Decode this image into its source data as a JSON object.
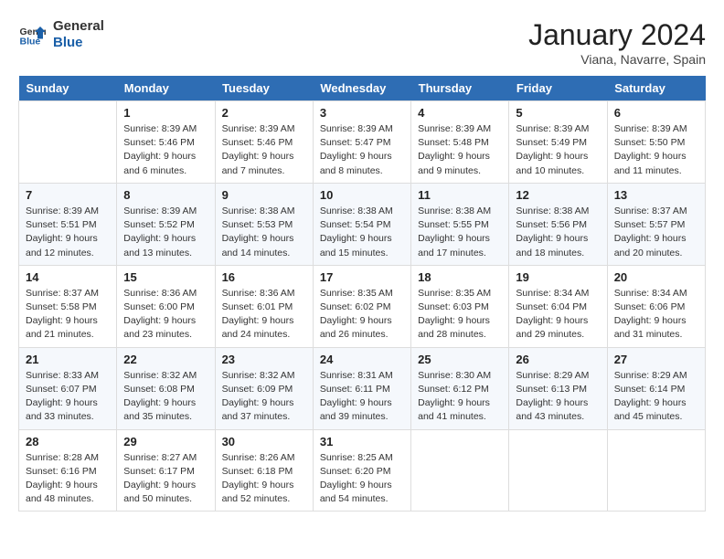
{
  "logo": {
    "line1": "General",
    "line2": "Blue"
  },
  "title": "January 2024",
  "location": "Viana, Navarre, Spain",
  "days_header": [
    "Sunday",
    "Monday",
    "Tuesday",
    "Wednesday",
    "Thursday",
    "Friday",
    "Saturday"
  ],
  "weeks": [
    [
      {
        "day": "",
        "sunrise": "",
        "sunset": "",
        "daylight": ""
      },
      {
        "day": "1",
        "sunrise": "Sunrise: 8:39 AM",
        "sunset": "Sunset: 5:46 PM",
        "daylight": "Daylight: 9 hours and 6 minutes."
      },
      {
        "day": "2",
        "sunrise": "Sunrise: 8:39 AM",
        "sunset": "Sunset: 5:46 PM",
        "daylight": "Daylight: 9 hours and 7 minutes."
      },
      {
        "day": "3",
        "sunrise": "Sunrise: 8:39 AM",
        "sunset": "Sunset: 5:47 PM",
        "daylight": "Daylight: 9 hours and 8 minutes."
      },
      {
        "day": "4",
        "sunrise": "Sunrise: 8:39 AM",
        "sunset": "Sunset: 5:48 PM",
        "daylight": "Daylight: 9 hours and 9 minutes."
      },
      {
        "day": "5",
        "sunrise": "Sunrise: 8:39 AM",
        "sunset": "Sunset: 5:49 PM",
        "daylight": "Daylight: 9 hours and 10 minutes."
      },
      {
        "day": "6",
        "sunrise": "Sunrise: 8:39 AM",
        "sunset": "Sunset: 5:50 PM",
        "daylight": "Daylight: 9 hours and 11 minutes."
      }
    ],
    [
      {
        "day": "7",
        "sunrise": "Sunrise: 8:39 AM",
        "sunset": "Sunset: 5:51 PM",
        "daylight": "Daylight: 9 hours and 12 minutes."
      },
      {
        "day": "8",
        "sunrise": "Sunrise: 8:39 AM",
        "sunset": "Sunset: 5:52 PM",
        "daylight": "Daylight: 9 hours and 13 minutes."
      },
      {
        "day": "9",
        "sunrise": "Sunrise: 8:38 AM",
        "sunset": "Sunset: 5:53 PM",
        "daylight": "Daylight: 9 hours and 14 minutes."
      },
      {
        "day": "10",
        "sunrise": "Sunrise: 8:38 AM",
        "sunset": "Sunset: 5:54 PM",
        "daylight": "Daylight: 9 hours and 15 minutes."
      },
      {
        "day": "11",
        "sunrise": "Sunrise: 8:38 AM",
        "sunset": "Sunset: 5:55 PM",
        "daylight": "Daylight: 9 hours and 17 minutes."
      },
      {
        "day": "12",
        "sunrise": "Sunrise: 8:38 AM",
        "sunset": "Sunset: 5:56 PM",
        "daylight": "Daylight: 9 hours and 18 minutes."
      },
      {
        "day": "13",
        "sunrise": "Sunrise: 8:37 AM",
        "sunset": "Sunset: 5:57 PM",
        "daylight": "Daylight: 9 hours and 20 minutes."
      }
    ],
    [
      {
        "day": "14",
        "sunrise": "Sunrise: 8:37 AM",
        "sunset": "Sunset: 5:58 PM",
        "daylight": "Daylight: 9 hours and 21 minutes."
      },
      {
        "day": "15",
        "sunrise": "Sunrise: 8:36 AM",
        "sunset": "Sunset: 6:00 PM",
        "daylight": "Daylight: 9 hours and 23 minutes."
      },
      {
        "day": "16",
        "sunrise": "Sunrise: 8:36 AM",
        "sunset": "Sunset: 6:01 PM",
        "daylight": "Daylight: 9 hours and 24 minutes."
      },
      {
        "day": "17",
        "sunrise": "Sunrise: 8:35 AM",
        "sunset": "Sunset: 6:02 PM",
        "daylight": "Daylight: 9 hours and 26 minutes."
      },
      {
        "day": "18",
        "sunrise": "Sunrise: 8:35 AM",
        "sunset": "Sunset: 6:03 PM",
        "daylight": "Daylight: 9 hours and 28 minutes."
      },
      {
        "day": "19",
        "sunrise": "Sunrise: 8:34 AM",
        "sunset": "Sunset: 6:04 PM",
        "daylight": "Daylight: 9 hours and 29 minutes."
      },
      {
        "day": "20",
        "sunrise": "Sunrise: 8:34 AM",
        "sunset": "Sunset: 6:06 PM",
        "daylight": "Daylight: 9 hours and 31 minutes."
      }
    ],
    [
      {
        "day": "21",
        "sunrise": "Sunrise: 8:33 AM",
        "sunset": "Sunset: 6:07 PM",
        "daylight": "Daylight: 9 hours and 33 minutes."
      },
      {
        "day": "22",
        "sunrise": "Sunrise: 8:32 AM",
        "sunset": "Sunset: 6:08 PM",
        "daylight": "Daylight: 9 hours and 35 minutes."
      },
      {
        "day": "23",
        "sunrise": "Sunrise: 8:32 AM",
        "sunset": "Sunset: 6:09 PM",
        "daylight": "Daylight: 9 hours and 37 minutes."
      },
      {
        "day": "24",
        "sunrise": "Sunrise: 8:31 AM",
        "sunset": "Sunset: 6:11 PM",
        "daylight": "Daylight: 9 hours and 39 minutes."
      },
      {
        "day": "25",
        "sunrise": "Sunrise: 8:30 AM",
        "sunset": "Sunset: 6:12 PM",
        "daylight": "Daylight: 9 hours and 41 minutes."
      },
      {
        "day": "26",
        "sunrise": "Sunrise: 8:29 AM",
        "sunset": "Sunset: 6:13 PM",
        "daylight": "Daylight: 9 hours and 43 minutes."
      },
      {
        "day": "27",
        "sunrise": "Sunrise: 8:29 AM",
        "sunset": "Sunset: 6:14 PM",
        "daylight": "Daylight: 9 hours and 45 minutes."
      }
    ],
    [
      {
        "day": "28",
        "sunrise": "Sunrise: 8:28 AM",
        "sunset": "Sunset: 6:16 PM",
        "daylight": "Daylight: 9 hours and 48 minutes."
      },
      {
        "day": "29",
        "sunrise": "Sunrise: 8:27 AM",
        "sunset": "Sunset: 6:17 PM",
        "daylight": "Daylight: 9 hours and 50 minutes."
      },
      {
        "day": "30",
        "sunrise": "Sunrise: 8:26 AM",
        "sunset": "Sunset: 6:18 PM",
        "daylight": "Daylight: 9 hours and 52 minutes."
      },
      {
        "day": "31",
        "sunrise": "Sunrise: 8:25 AM",
        "sunset": "Sunset: 6:20 PM",
        "daylight": "Daylight: 9 hours and 54 minutes."
      },
      {
        "day": "",
        "sunrise": "",
        "sunset": "",
        "daylight": ""
      },
      {
        "day": "",
        "sunrise": "",
        "sunset": "",
        "daylight": ""
      },
      {
        "day": "",
        "sunrise": "",
        "sunset": "",
        "daylight": ""
      }
    ]
  ]
}
